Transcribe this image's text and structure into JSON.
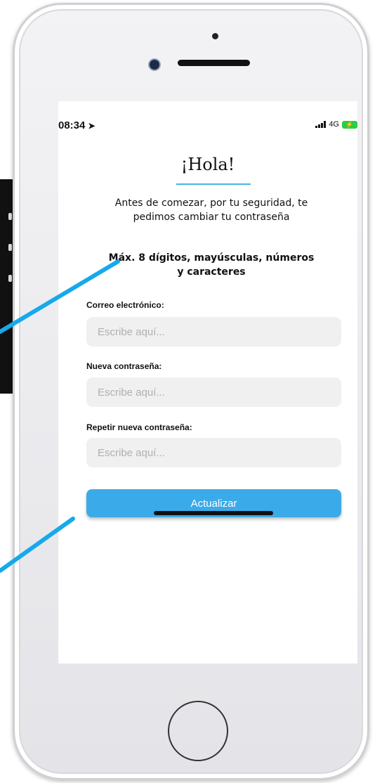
{
  "status_bar": {
    "time": "08:34",
    "location_icon": "location-arrow-icon",
    "network": "4G",
    "signal_icon": "signal-bars-icon",
    "battery_icon": "battery-charging-icon"
  },
  "screen": {
    "title": "¡Hola!",
    "intro": "Antes de comezar, por tu seguridad, te pedimos cambiar tu contraseña",
    "rules": "Máx. 8 dígitos, mayúsculas, números y caracteres",
    "fields": [
      {
        "label": "Correo electrónico:",
        "placeholder": "Escribe aquí...",
        "value": ""
      },
      {
        "label": "Nueva contraseña:",
        "placeholder": "Escribe aquí...",
        "value": ""
      },
      {
        "label": "Repetir nueva contraseña:",
        "placeholder": "Escribe aquí...",
        "value": ""
      }
    ],
    "submit_label": "Actualizar"
  },
  "colors": {
    "accent": "#3baae8",
    "callout": "#16a9ec",
    "input_bg": "#f0f0f0"
  }
}
